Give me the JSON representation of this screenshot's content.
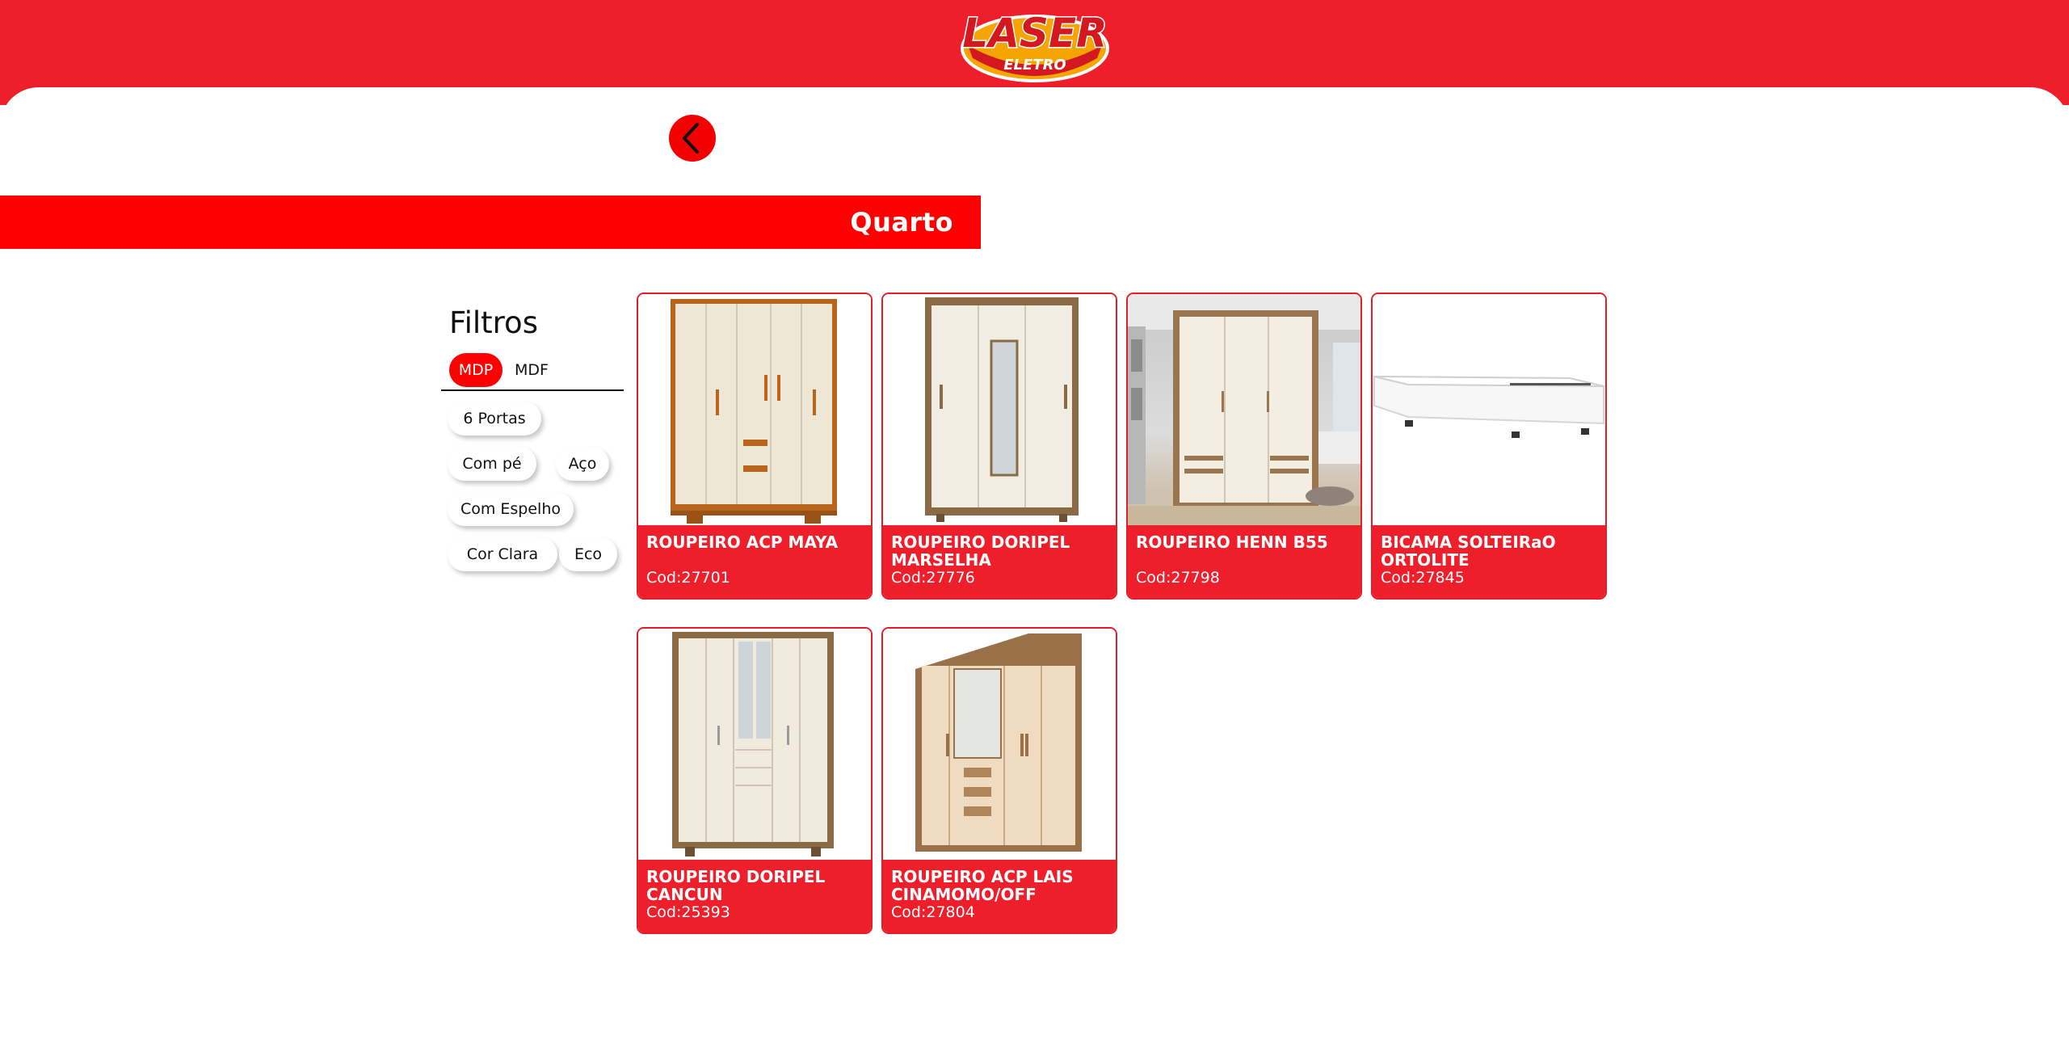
{
  "brand": {
    "logo_text": "LASER",
    "logo_sub": "ELETRO",
    "primary_color": "#ef1e2b",
    "accent_color": "#ff0000"
  },
  "navigation": {
    "back_icon": "chevron-left-icon"
  },
  "category": {
    "title": "Quarto"
  },
  "filters": {
    "title": "Filtros",
    "materials": [
      {
        "label": "MDP",
        "active": true
      },
      {
        "label": "MDF",
        "active": false
      }
    ],
    "chips": [
      "6 Portas",
      "Com pé",
      "Aço",
      "Com Espelho",
      "Cor Clara",
      "Eco"
    ]
  },
  "products": [
    {
      "name": "ROUPEIRO ACP MAYA",
      "code": "Cod:27701"
    },
    {
      "name": "ROUPEIRO DORIPEL MARSELHA",
      "code": "Cod:27776"
    },
    {
      "name": "ROUPEIRO HENN B55",
      "code": "Cod:27798"
    },
    {
      "name": "BICAMA SOLTEIRaO ORTOLITE",
      "code": "Cod:27845"
    },
    {
      "name": "ROUPEIRO DORIPEL CANCUN",
      "code": "Cod:25393"
    },
    {
      "name": "ROUPEIRO ACP LAIS CINAMOMO/OFF",
      "code": "Cod:27804"
    }
  ]
}
